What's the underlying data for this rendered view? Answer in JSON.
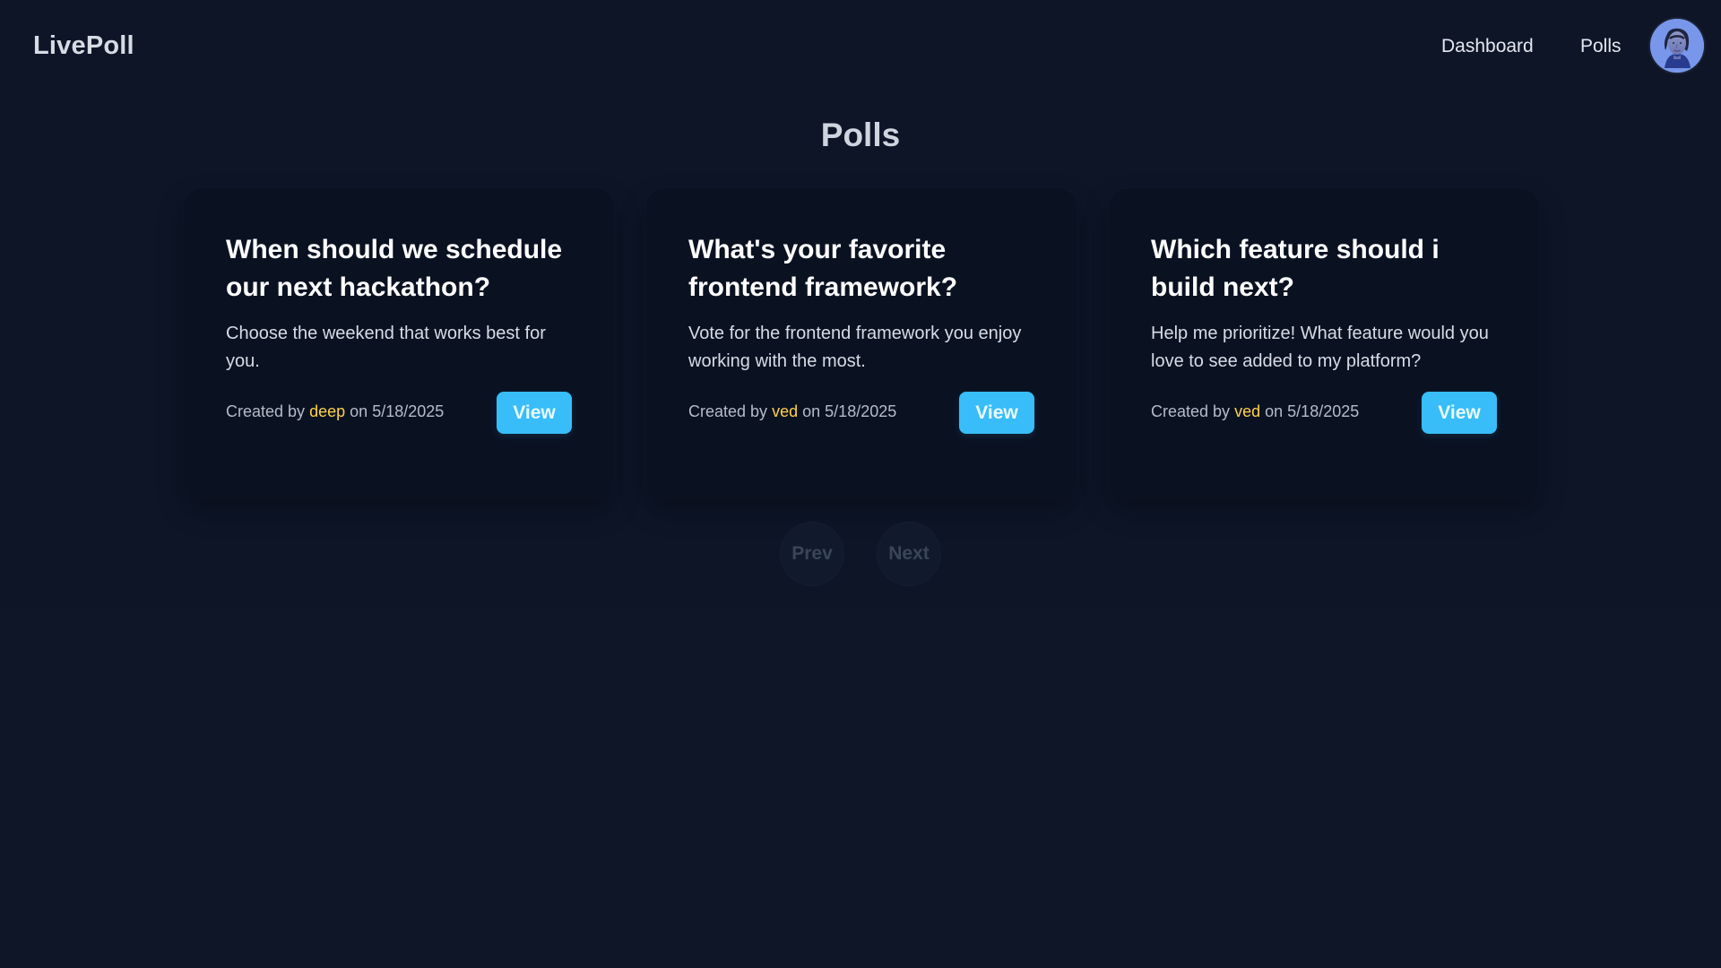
{
  "app": {
    "brand": "LivePoll"
  },
  "nav": {
    "items": [
      {
        "label": "Dashboard"
      },
      {
        "label": "Polls"
      }
    ],
    "avatar": "profile-avatar"
  },
  "page": {
    "title": "Polls"
  },
  "polls": [
    {
      "title": "When should we schedule our next hackathon?",
      "description": "Choose the weekend that works best for you.",
      "created_by_prefix": "Created by",
      "author": "deep",
      "date_prefix": "on",
      "date": "5/18/2025",
      "view_label": "View"
    },
    {
      "title": "What's your favorite frontend framework?",
      "description": "Vote for the frontend framework you enjoy working with the most.",
      "created_by_prefix": "Created by",
      "author": "ved",
      "date_prefix": "on",
      "date": "5/18/2025",
      "view_label": "View"
    },
    {
      "title": "Which feature should i build next?",
      "description": "Help me prioritize! What feature would you love to see added to my platform?",
      "created_by_prefix": "Created by",
      "author": "ved",
      "date_prefix": "on",
      "date": "5/18/2025",
      "view_label": "View"
    }
  ],
  "pagination": {
    "prev": "Prev",
    "next": "Next"
  },
  "colors": {
    "background": "#0e1628",
    "card": "#0a1222",
    "accent": "#38bdf8",
    "author": "#ffd24a",
    "text_primary": "#ffffff",
    "text_secondary": "#d7dce6",
    "text_muted": "#b5bcc8"
  },
  "icons": {
    "avatar": "user-avatar-icon"
  }
}
